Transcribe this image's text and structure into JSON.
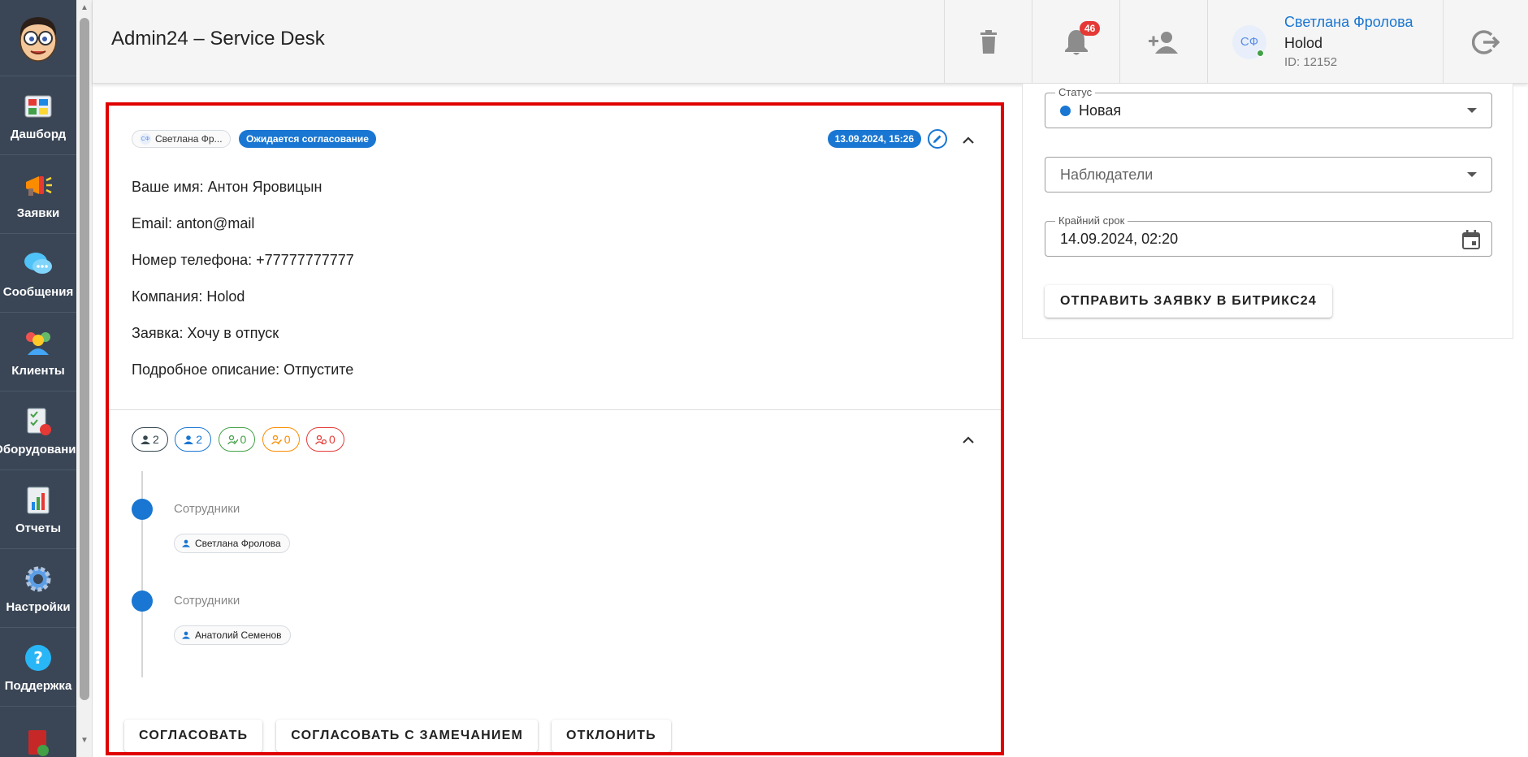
{
  "app": {
    "title": "Admin24 – Service Desk"
  },
  "sidebar": {
    "items": [
      {
        "label": "Дашборд",
        "icon": "dashboard-icon"
      },
      {
        "label": "Заявки",
        "icon": "megaphone-icon"
      },
      {
        "label": "Сообщения",
        "icon": "chat-icon"
      },
      {
        "label": "Клиенты",
        "icon": "clients-icon"
      },
      {
        "label": "Оборудование",
        "icon": "equipment-icon"
      },
      {
        "label": "Отчеты",
        "icon": "report-icon"
      },
      {
        "label": "Настройки",
        "icon": "gear-icon"
      },
      {
        "label": "Поддержка",
        "icon": "help-icon"
      }
    ]
  },
  "header": {
    "notifications_count": "46",
    "user": {
      "initials": "СФ",
      "name": "Светлана Фролова",
      "company": "Holod",
      "id_text": "ID: 12152"
    }
  },
  "ticket": {
    "author_chip": "Светлана Фр...",
    "author_initials": "СФ",
    "status_chip": "Ожидается согласование",
    "date": "13.09.2024, 15:26",
    "fields": [
      "Ваше имя: Антон Яровицын",
      "Email: anton@mail",
      "Номер телефона: +77777777777",
      "Компания: Holod",
      "Заявка: Хочу в отпуск",
      "Подробное описание: Отпустите"
    ],
    "counters": [
      {
        "value": "2",
        "color": "#37474f"
      },
      {
        "value": "2",
        "color": "#1976d2"
      },
      {
        "value": "0",
        "color": "#43a047"
      },
      {
        "value": "0",
        "color": "#fb8c00"
      },
      {
        "value": "0",
        "color": "#e53935"
      }
    ],
    "timeline": [
      {
        "label": "Сотрудники",
        "person": "Светлана Фролова"
      },
      {
        "label": "Сотрудники",
        "person": "Анатолий Семенов"
      }
    ],
    "actions": {
      "approve": "СОГЛАСОВАТЬ",
      "approve_comment": "СОГЛАСОВАТЬ С ЗАМЕЧАНИЕМ",
      "reject": "ОТКЛОНИТЬ"
    }
  },
  "panel": {
    "status": {
      "legend": "Статус",
      "value": "Новая",
      "color": "#1976d2"
    },
    "watchers": {
      "placeholder": "Наблюдатели"
    },
    "deadline": {
      "legend": "Крайний срок",
      "value": "14.09.2024, 02:20"
    },
    "bitrix_button": "ОТПРАВИТЬ ЗАЯВКУ В БИТРИКС24"
  }
}
